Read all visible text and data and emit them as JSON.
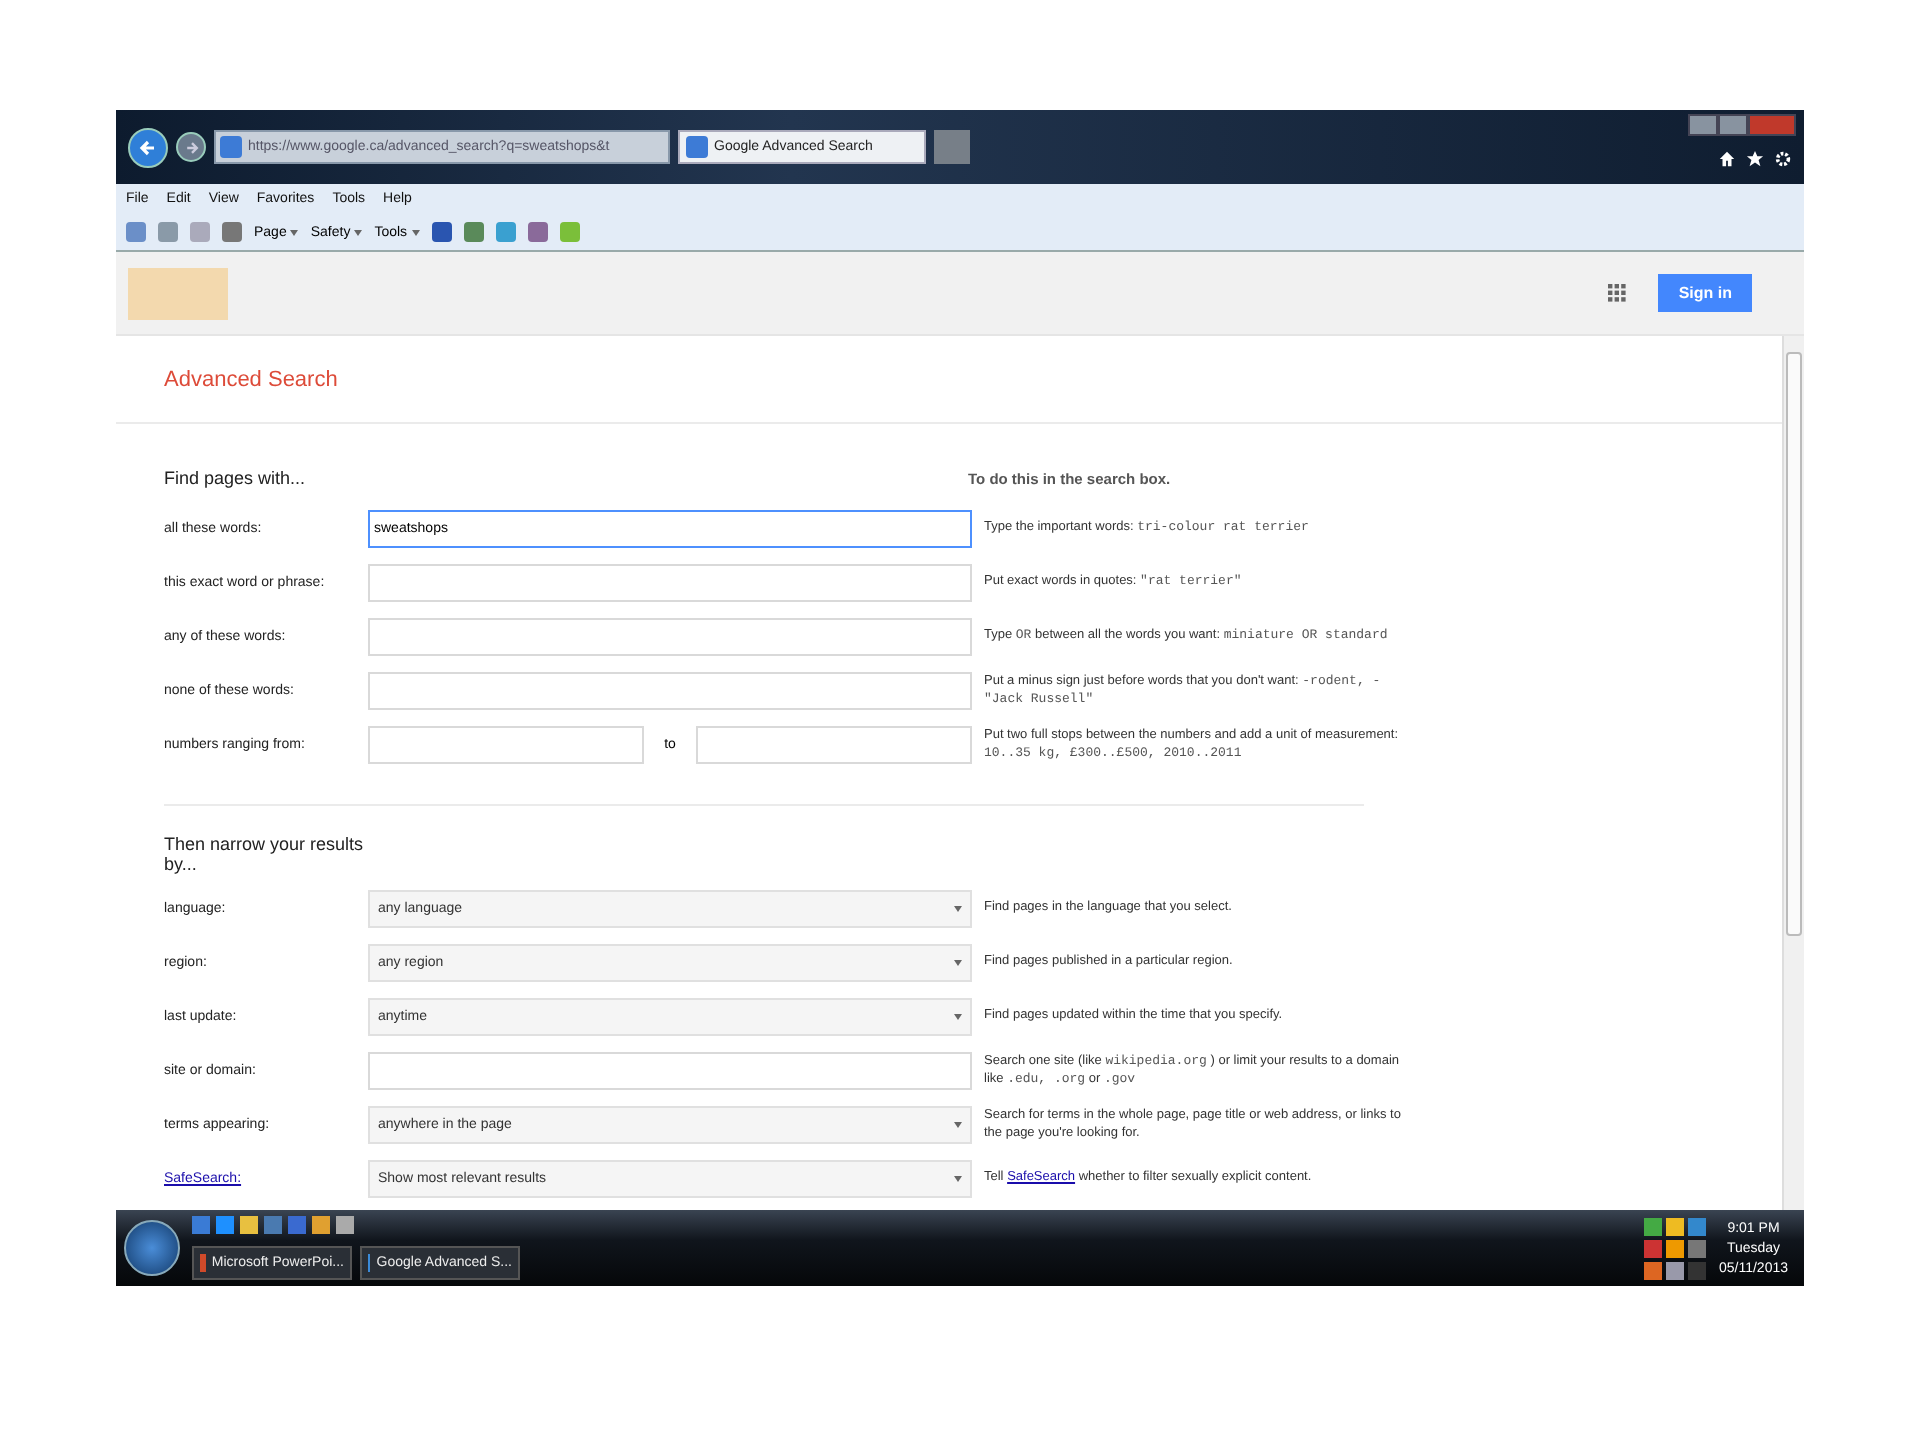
{
  "browser": {
    "address": "https://www.google.ca/advanced_search?q=sweatshops&t",
    "tab_title": "Google Advanced Search"
  },
  "menu": [
    "File",
    "Edit",
    "View",
    "Favorites",
    "Tools",
    "Help"
  ],
  "command_bar": [
    "Page",
    "Safety",
    "Tools"
  ],
  "header": {
    "sign_in": "Sign in"
  },
  "title": "Advanced Search",
  "section_1": {
    "heading": "Find pages with...",
    "hint_heading": "To do this in the search box.",
    "rows": [
      {
        "kind": "text",
        "label": "all these words:",
        "value": "sweatshops",
        "focused": true,
        "hint": [
          {
            "kind": "plain",
            "text": "Type the important words: "
          },
          {
            "kind": "code",
            "text": "tri-colour rat terrier"
          }
        ]
      },
      {
        "kind": "text",
        "label": "this exact word or phrase:",
        "focused": false,
        "hint": [
          {
            "kind": "plain",
            "text": "Put exact words in quotes: "
          },
          {
            "kind": "code",
            "text": "\"rat terrier\""
          }
        ]
      },
      {
        "kind": "text",
        "label": "any of these words:",
        "focused": false,
        "hint": [
          {
            "kind": "plain",
            "text": "Type "
          },
          {
            "kind": "code",
            "text": "OR"
          },
          {
            "kind": "plain",
            "text": " between all the words you want: "
          },
          {
            "kind": "code",
            "text": "miniature OR standard"
          }
        ]
      },
      {
        "kind": "text",
        "label": "none of these words:",
        "focused": false,
        "hint": [
          {
            "kind": "plain",
            "text": "Put a minus sign just before words that you don't want: "
          },
          {
            "kind": "code",
            "text": "-rodent, -\"Jack Russell\""
          }
        ]
      },
      {
        "kind": "range",
        "label": "numbers ranging from:",
        "between": "to",
        "focused": false,
        "hint": [
          {
            "kind": "plain",
            "text": "Put two full stops between the numbers and add a unit of measurement: "
          },
          {
            "kind": "code",
            "text": "10..35 kg, £300..£500, 2010..2011"
          }
        ]
      }
    ]
  },
  "section_2": {
    "heading": "Then narrow your results by...",
    "rows": [
      {
        "kind": "select",
        "label": "language:",
        "value": "any language",
        "focused": false,
        "hint": [
          {
            "kind": "plain",
            "text": "Find pages in the language that you select."
          }
        ]
      },
      {
        "kind": "select",
        "label": "region:",
        "value": "any region",
        "focused": false,
        "hint": [
          {
            "kind": "plain",
            "text": "Find pages published in a particular region."
          }
        ]
      },
      {
        "kind": "select",
        "label": "last update:",
        "value": "anytime",
        "focused": false,
        "hint": [
          {
            "kind": "plain",
            "text": "Find pages updated within the time that you specify."
          }
        ]
      },
      {
        "kind": "text",
        "label": "site or domain:",
        "focused": false,
        "hint": [
          {
            "kind": "plain",
            "text": "Search one site (like "
          },
          {
            "kind": "code",
            "text": "wikipedia.org"
          },
          {
            "kind": "plain",
            "text": " ) or limit your results to a domain like "
          },
          {
            "kind": "code",
            "text": ".edu, .org"
          },
          {
            "kind": "plain",
            "text": " or "
          },
          {
            "kind": "code",
            "text": ".gov"
          }
        ]
      },
      {
        "kind": "select",
        "label": "terms appearing:",
        "value": "anywhere in the page",
        "focused": false,
        "hint": [
          {
            "kind": "plain",
            "text": "Search for terms in the whole page, page title or web address, or links to the page you're looking for."
          }
        ]
      },
      {
        "kind": "select",
        "label": "SafeSearch:",
        "label_link": true,
        "value": "Show most relevant results",
        "focused": false,
        "hint": [
          {
            "kind": "plain",
            "text": "Tell "
          },
          {
            "kind": "link",
            "text": "SafeSearch"
          },
          {
            "kind": "plain",
            "text": " whether to filter sexually explicit content."
          }
        ]
      }
    ]
  },
  "taskbar": {
    "tasks": [
      "Microsoft PowerPoi...",
      "Google Advanced S..."
    ],
    "time": "9:01 PM",
    "day": "Tuesday",
    "date": "05/11/2013"
  }
}
